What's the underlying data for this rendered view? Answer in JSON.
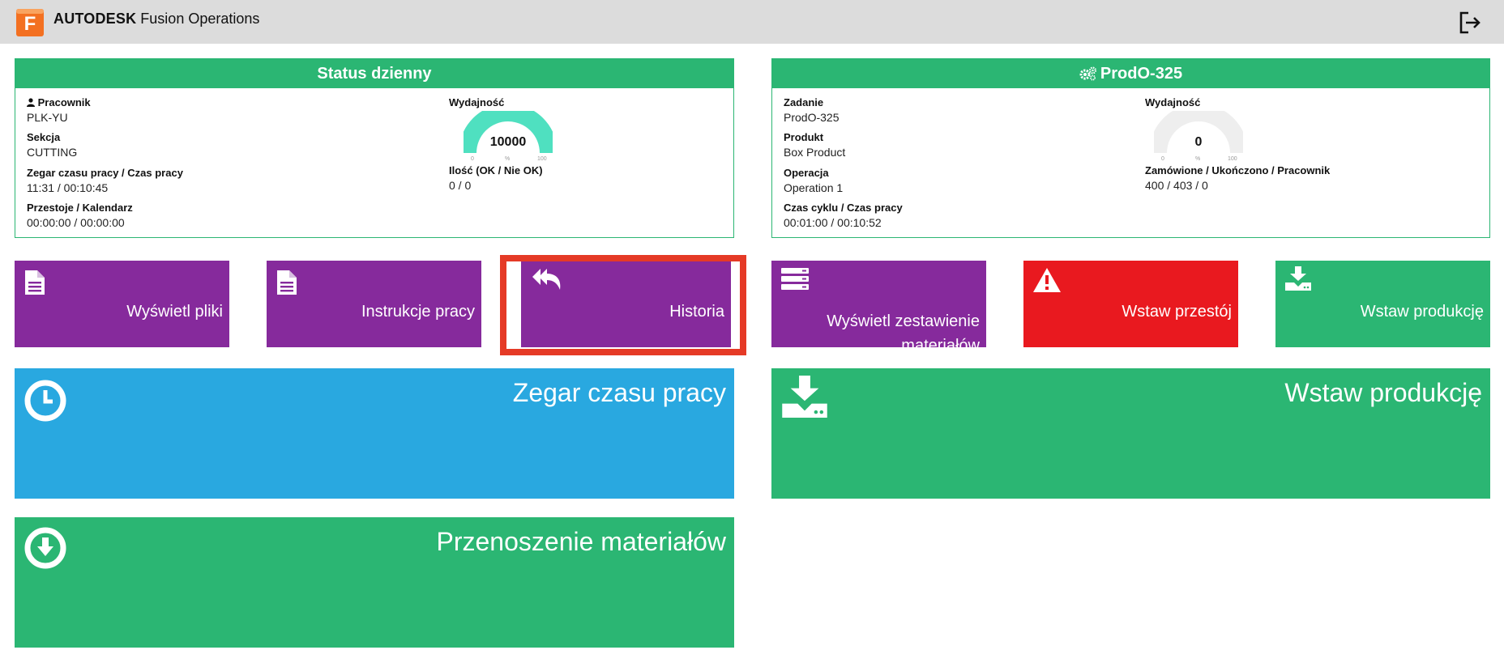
{
  "header": {
    "brand_bold": "AUTODESK",
    "brand_rest": "Fusion Operations",
    "logo_letter": "F",
    "logout_icon": "logout-icon"
  },
  "daily_status": {
    "title": "Status dzienny",
    "worker_label": "Pracownik",
    "worker_value": "PLK-YU",
    "section_label": "Sekcja",
    "section_value": "CUTTING",
    "clock_label": "Zegar czasu pracy / Czas pracy",
    "clock_value": "11:31 / 00:10:45",
    "downtime_label": "Przestoje / Kalendarz",
    "downtime_value": "00:00:00 / 00:00:00",
    "efficiency_label": "Wydajność",
    "efficiency_value": "10000",
    "efficiency_fill": 1.0,
    "gauge_min": "0",
    "gauge_unit": "%",
    "gauge_max": "100",
    "qty_label": "Ilość (OK / Nie OK)",
    "qty_value": "0 / 0"
  },
  "order": {
    "title": "ProdO-325",
    "task_label": "Zadanie",
    "task_value": "ProdO-325",
    "product_label": "Produkt",
    "product_value": "Box Product",
    "operation_label": "Operacja",
    "operation_value": "Operation 1",
    "cycle_label": "Czas cyklu / Czas pracy",
    "cycle_value": "00:01:00 / 00:10:52",
    "efficiency_label": "Wydajność",
    "efficiency_value": "0",
    "efficiency_fill": 0.0,
    "gauge_min": "0",
    "gauge_unit": "%",
    "gauge_max": "100",
    "ordered_label": "Zamówione / Ukończono / Pracownik",
    "ordered_value": "400 / 403 / 0"
  },
  "tiles": {
    "files": "Wyświetl pliki",
    "instructions": "Instrukcje pracy",
    "history": "Historia",
    "bom_line1": "Wyświetl zestawienie",
    "bom_line2": "materiałów",
    "downtime": "Wstaw przestój",
    "production_small": "Wstaw produkcję",
    "work_clock": "Zegar czasu pracy",
    "production_big": "Wstaw produkcję",
    "material_transfer": "Przenoszenie materiałów"
  },
  "colors": {
    "green": "#2bb673",
    "purple": "#862a9c",
    "red": "#e9191f",
    "blue": "#29a8e0",
    "gauge_active": "#4fe0c0",
    "gauge_inactive": "#eeeeee",
    "highlight": "#e53a26"
  }
}
